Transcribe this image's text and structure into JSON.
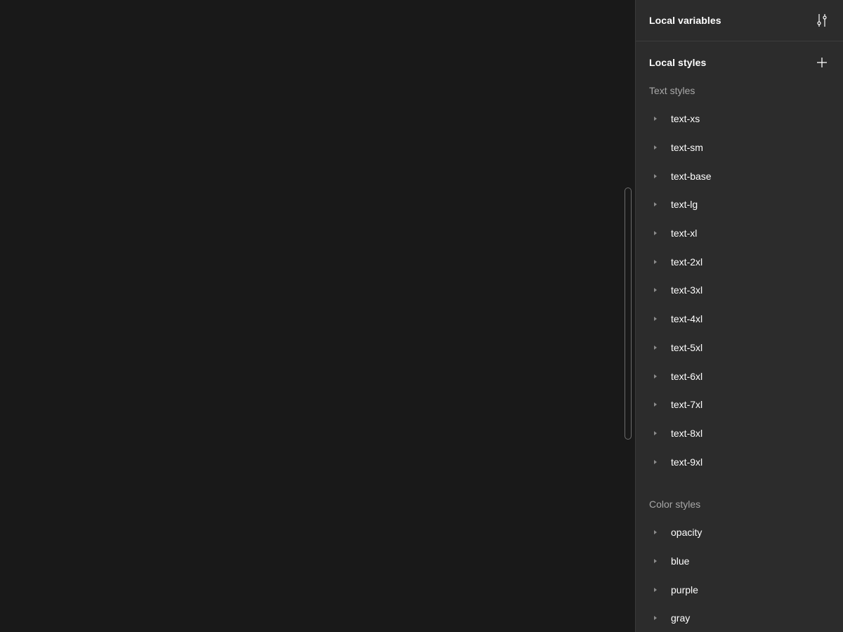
{
  "panel": {
    "variables_title": "Local variables",
    "variables_icon": "sliders-icon",
    "styles_title": "Local styles",
    "styles_icon": "plus-icon",
    "text_styles": {
      "label": "Text styles",
      "items": [
        "text-xs",
        "text-sm",
        "text-base",
        "text-lg",
        "text-xl",
        "text-2xl",
        "text-3xl",
        "text-4xl",
        "text-5xl",
        "text-6xl",
        "text-7xl",
        "text-8xl",
        "text-9xl"
      ]
    },
    "color_styles": {
      "label": "Color styles",
      "items": [
        "opacity",
        "blue",
        "purple",
        "gray"
      ]
    }
  },
  "colors": {
    "canvas_bg": "#191919",
    "panel_bg": "#2c2c2c",
    "muted_text": "#a8a8a8",
    "caret": "#8c8c8c"
  }
}
